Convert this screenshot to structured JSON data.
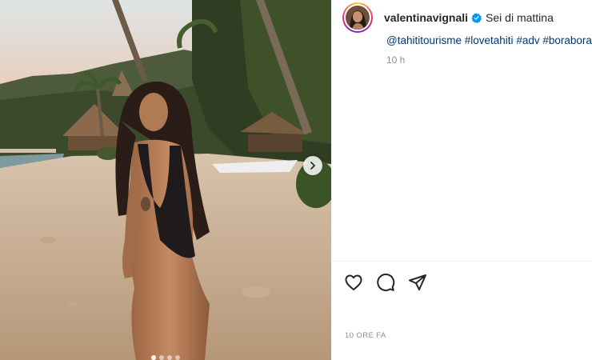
{
  "post": {
    "username": "valentinavignali",
    "verified": true,
    "caption_text": "Sei di mattina",
    "caption_tags": [
      "@tahititourisme",
      "#lovetahiti",
      "#adv",
      "#borabora"
    ],
    "comment_age": "10 h",
    "time_ago": "10 ORE FA"
  },
  "media": {
    "description_icon": "beach-photo",
    "carousel": {
      "total": 4,
      "active_index": 0
    }
  },
  "actions": {
    "like_icon": "heart-icon",
    "comment_icon": "comment-icon",
    "share_icon": "send-icon"
  },
  "colors": {
    "link": "#00376b",
    "muted": "#8e8e8e",
    "text": "#262626",
    "verified": "#0095f6"
  }
}
